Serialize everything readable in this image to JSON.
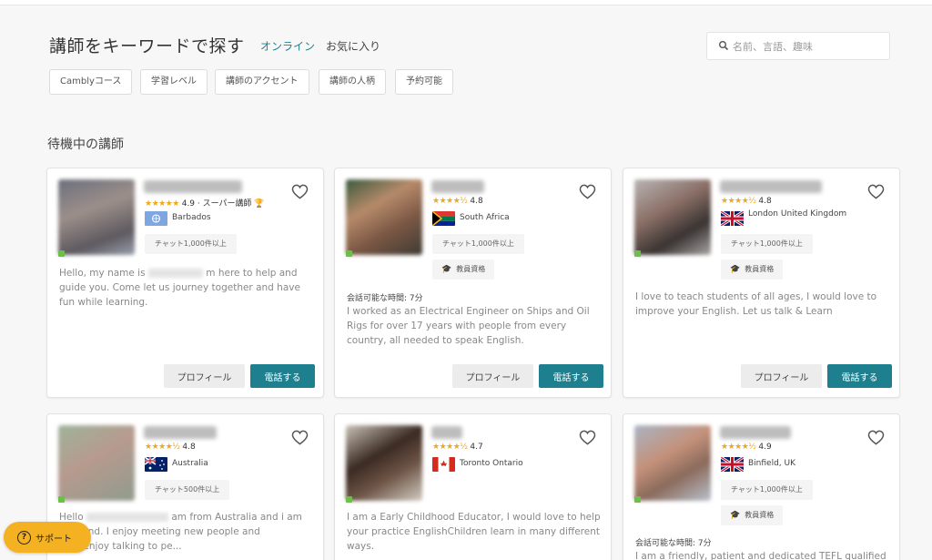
{
  "header": {
    "title": "講師をキーワードで探す",
    "tab_online": "オンライン",
    "tab_favorites": "お気に入り",
    "search_placeholder": "名前、言語、趣味"
  },
  "filters": [
    "Camblyコース",
    "学習レベル",
    "講師のアクセント",
    "講師の人柄",
    "予約可能"
  ],
  "section_title": "待機中の講師",
  "labels": {
    "profile": "プロフィール",
    "call": "電話する",
    "edu": "教員資格",
    "avail": "会話可能な時間: 7分"
  },
  "tutors": [
    {
      "rating": "4.9 · スーパー講師",
      "country": "Barbados",
      "chats": "チャット1,000件以上",
      "desc_a": "Hello, my name is",
      "desc_b": "m here to help and guide you. Come let us journey together and have fun while learning."
    },
    {
      "rating": "4.8",
      "country": "South Africa",
      "chats": "チャット1,000件以上",
      "desc": "I worked as an Electrical Engineer on Ships and Oil Rigs for over 17 years with people from every country, all needed to speak English."
    },
    {
      "rating": "4.8",
      "country": "London United Kingdom",
      "chats": "チャット1,000件以上",
      "desc": "I love to teach students of all ages, I would love to improve your English. Let us talk & Learn"
    },
    {
      "rating": "4.8",
      "country": "Australia",
      "chats": "チャット500件以上",
      "desc_a": "Hello",
      "desc_b": "am from Australia and i am",
      "desc_c": "Thailand. I enjoy meeting new people and",
      "desc_d": "ng. I enjoy talking to pe..."
    },
    {
      "rating": "4.7",
      "country": "Toronto Ontario",
      "desc": "I am a Early Childhood Educator, I would love to help your practice EnglishChildren learn in many different ways."
    },
    {
      "rating": "4.9",
      "country": "Binfield, UK",
      "chats": "チャット1,000件以上",
      "desc": "I am a friendly, patient and dedicated TEFL qualified ESL"
    }
  ],
  "support_label": "サポート",
  "colors": {
    "accent": "#1e7f8f",
    "stars": "#f0a81b",
    "support": "#f4b223"
  }
}
